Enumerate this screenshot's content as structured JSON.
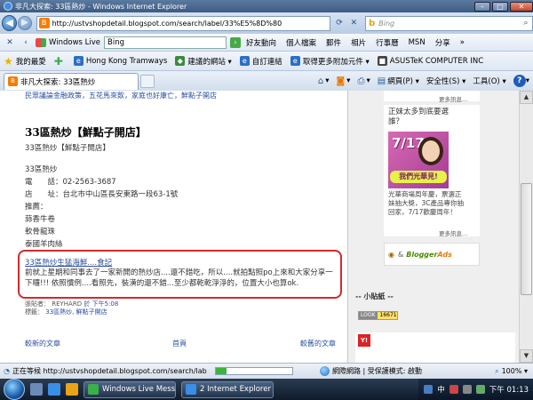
{
  "window": {
    "title": "非凡大探索: 33區熱炒 - Windows Internet Explorer",
    "minimize": "–",
    "maximize": "□",
    "close": "✕"
  },
  "address": {
    "url": "http://ustvshopdetail.blogspot.com/search/label/33%E5%8D%80",
    "search_placeholder": "Bing"
  },
  "wl_toolbar": {
    "brand": "Windows Live",
    "search_value": "Bing",
    "items": [
      "好友動向",
      "個人檔案",
      "郵件",
      "相片",
      "行事曆",
      "MSN",
      "分享"
    ]
  },
  "favorites": {
    "label": "我的最愛",
    "items": [
      "Hong Kong Tramways",
      "建議的網站 ▾",
      "自訂連結",
      "取得更多附加元件 ▾",
      "ASUSTeK COMPUTER INC"
    ]
  },
  "commandbar": {
    "tab_title": "非凡大探索: 33區熱炒",
    "items": [
      "網頁(P) ▾",
      "安全性(S) ▾",
      "工具(O) ▾"
    ]
  },
  "post": {
    "prev_excerpt": "民眾議論金融政策，五花馬來飲，家庭也好康亡，鮮點子開店",
    "title": "33區熱炒【鮮點子開店】",
    "subtitle": "33區熱炒【鮮點子開店】",
    "lines": [
      "33區熱炒",
      "電　　話：02-2563-3687",
      "店　　址：台北市中山區長安東路一段63-1號",
      "推薦：",
      "蒜香牛卷",
      "軟骨龍珠",
      "泰國羊肉絲"
    ],
    "highlight_link": "33區熱炒生猛海鮮....食記",
    "highlight_body": "前就上星期和同事去了一家新開的熱炒店....還不錯吃，所以....就拍點照po上來和大家分享一下囉!!! 依照慣例....看照先，裝潢的還不錯...至少都乾乾淨淨的，位置大小也算ok.",
    "posted_by_label": "張貼者：",
    "author": "REYHARD",
    "posted_time": "於 下午5:08",
    "labels_label": "標籤：",
    "labels": "33區熱炒, 鮮點子開店",
    "nav_newer": "較新的文章",
    "nav_home": "首頁",
    "nav_older": "較舊的文章"
  },
  "sidebar": {
    "more1": "更多訊息...",
    "ad_title": "正妹太多到底要選誰？",
    "ad_date": "7/17",
    "ad_banner": "我們光華見!",
    "ad_desc": "光華商場周年慶，票選正妹抽大獎，3C產品專你抽回家，7/17歡慶周年！",
    "more2": "更多訊息...",
    "blogger_ads_a": "Blogger",
    "blogger_ads_b": "Ads",
    "section_title": "-- 小貼紙 --",
    "counter_label": "LOOK",
    "counter_value": "16671"
  },
  "status": {
    "text": "正在等候 http://ustvshopdetail.blogspot.com/search/lab",
    "progress": 0.14,
    "zone": "網際網路 | 受保護模式: 啟動",
    "zoom": "100%"
  },
  "taskbar": {
    "task1": "Windows Live Mess...",
    "task2": "2 Internet Explorer",
    "tray_lang": "中",
    "clock": "下午 01:13"
  }
}
